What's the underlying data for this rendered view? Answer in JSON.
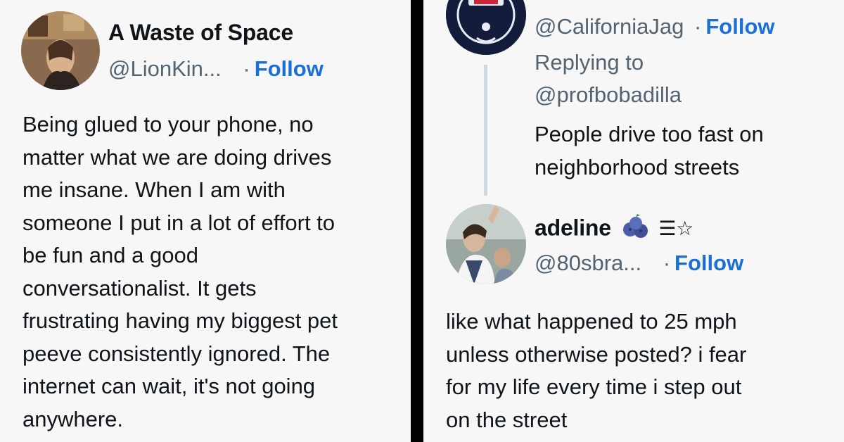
{
  "left_tweet": {
    "display_name": "A Waste of Space",
    "handle": "@LionKin...",
    "follow_label": "Follow",
    "separator": "·",
    "text": "Being glued to your phone, no\nmatter what we are doing drives\nme insane. When I am with\nsomeone I put in a lot of effort to\nbe fun and a good\nconversationalist. It gets\nfrustrating having my biggest pet\npeeve consistently ignored. The\ninternet can wait, it's not going\nanywhere."
  },
  "right_top_tweet": {
    "handle": "@CaliforniaJag",
    "separator": "·",
    "follow_label": "Follow",
    "replying_label": "Replying to",
    "replying_to": "@profbobadilla",
    "text": "People drive too fast on\nneighborhood streets"
  },
  "right_bottom_tweet": {
    "display_name": "adeline",
    "name_symbols": "☰☆",
    "name_emoji": "blueberries-emoji",
    "handle": "@80sbra...",
    "separator": "·",
    "follow_label": "Follow",
    "text": "like what happened to 25 mph\nunless otherwise posted? i fear\nfor my life every time i step out\non the street"
  },
  "colors": {
    "follow_blue": "#1d6fd8",
    "muted_gray": "#536471",
    "panel_bg": "#f7f7f7",
    "divider": "#000000"
  }
}
